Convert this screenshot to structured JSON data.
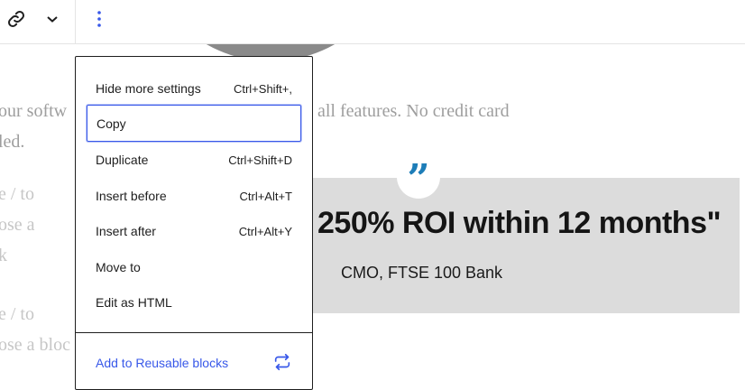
{
  "toolbar": {
    "link_icon": "link-icon",
    "chevron_icon": "chevron-down-icon",
    "options_icon": "more-vertical-icon",
    "options_color": "#3858e9"
  },
  "background": {
    "lines": [
      {
        "left": "our softw",
        "right": "all features. No credit card"
      },
      {
        "left": "led."
      },
      {
        "left": "e / to"
      },
      {
        "left": "ose a"
      },
      {
        "left": "k"
      },
      {
        "left": "e / to"
      },
      {
        "left": "ose a bloc"
      }
    ]
  },
  "quote": {
    "mark": "”",
    "mark_color": "#1d7db8",
    "text": "250% ROI within 12 months\"",
    "citation": "CMO, FTSE 100 Bank"
  },
  "menu": {
    "items": [
      {
        "label": "Hide more settings",
        "shortcut": "Ctrl+Shift+,"
      },
      {
        "label": "Copy",
        "shortcut": ""
      },
      {
        "label": "Duplicate",
        "shortcut": "Ctrl+Shift+D"
      },
      {
        "label": "Insert before",
        "shortcut": "Ctrl+Alt+T"
      },
      {
        "label": "Insert after",
        "shortcut": "Ctrl+Alt+Y"
      },
      {
        "label": "Move to",
        "shortcut": ""
      },
      {
        "label": "Edit as HTML",
        "shortcut": ""
      }
    ],
    "reusable": {
      "label": "Add to Reusable blocks",
      "icon": "reusable-block-icon"
    },
    "accent": "#3858e9"
  }
}
